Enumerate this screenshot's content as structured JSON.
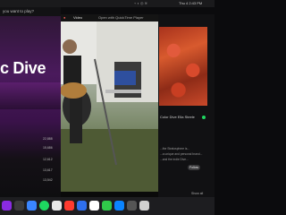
{
  "left_app": {
    "search_text": "you want to play?",
    "hero_title": "c Dive",
    "stats": [
      "22,888",
      "15,686",
      "12,612",
      "13,617",
      "13,542"
    ]
  },
  "video_window": {
    "title": "Video",
    "link_text": "Open with QuickTime Player"
  },
  "right_panel": {
    "caption": "Color Dive Ella Steele",
    "desc_lines": [
      "...the Stratosphere is...",
      "...a unique and personal brand...",
      "...and the indie Dive..."
    ],
    "follow_label": "Follow",
    "show_all": "Show all"
  },
  "menubar": {
    "right_items": [
      "Thu 4 2:43 PM"
    ]
  },
  "colors": {
    "accent_green": "#1ed760",
    "purple": "#5b1f6d"
  }
}
